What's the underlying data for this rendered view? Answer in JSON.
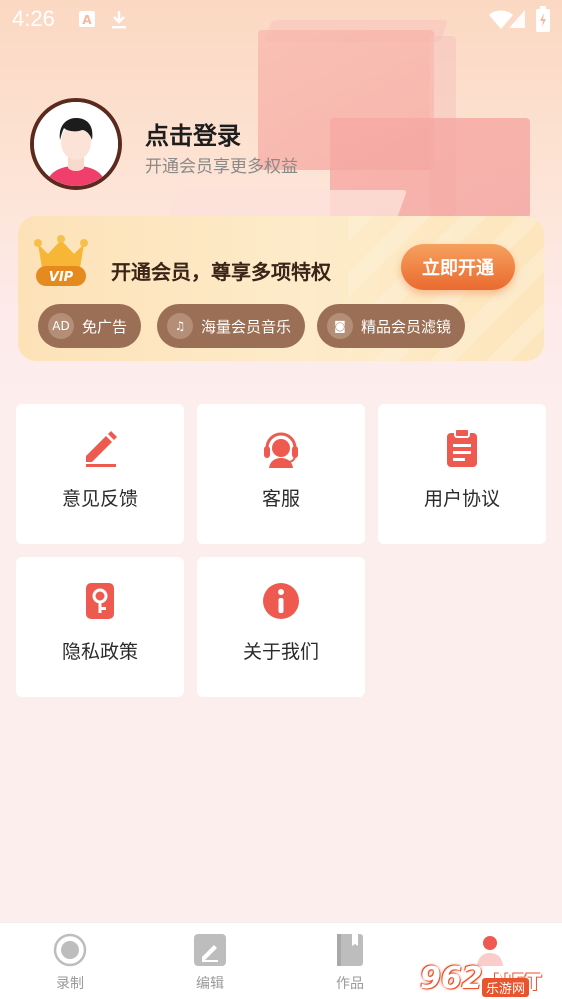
{
  "status_bar": {
    "time": "4:26",
    "icons": [
      "a-notification-icon",
      "download-icon",
      "wifi-icon",
      "cell-signal-icon",
      "battery-icon"
    ]
  },
  "profile": {
    "title": "点击登录",
    "subtitle": "开通会员享更多权益"
  },
  "vip_card": {
    "badge": "VIP",
    "title": "开通会员，尊享多项特权",
    "button": "立即开通",
    "perks": [
      {
        "label": "免广告",
        "icon": "no-ad-icon",
        "icon_text": "AD"
      },
      {
        "label": "海量会员音乐",
        "icon": "music-note-icon",
        "icon_text": "♫"
      },
      {
        "label": "精品会员滤镜",
        "icon": "filter-icon",
        "icon_text": "◙"
      }
    ]
  },
  "menu": [
    {
      "label": "意见反馈",
      "icon": "pencil-icon"
    },
    {
      "label": "客服",
      "icon": "headset-icon"
    },
    {
      "label": "用户协议",
      "icon": "clipboard-icon"
    },
    {
      "label": "隐私政策",
      "icon": "key-icon"
    },
    {
      "label": "关于我们",
      "icon": "info-icon"
    }
  ],
  "bottom_nav": [
    {
      "label": "录制",
      "icon": "record-icon"
    },
    {
      "label": "编辑",
      "icon": "edit-icon"
    },
    {
      "label": "作品",
      "icon": "book-icon"
    },
    {
      "label": "",
      "icon": "profile-icon"
    }
  ],
  "watermark": {
    "number": "962",
    "suffix": ".NET",
    "sub": "乐游网"
  },
  "colors": {
    "accent": "#ee5a4f",
    "vip_button": "#ea6a2f",
    "perk_bg": "#9a6f55"
  }
}
